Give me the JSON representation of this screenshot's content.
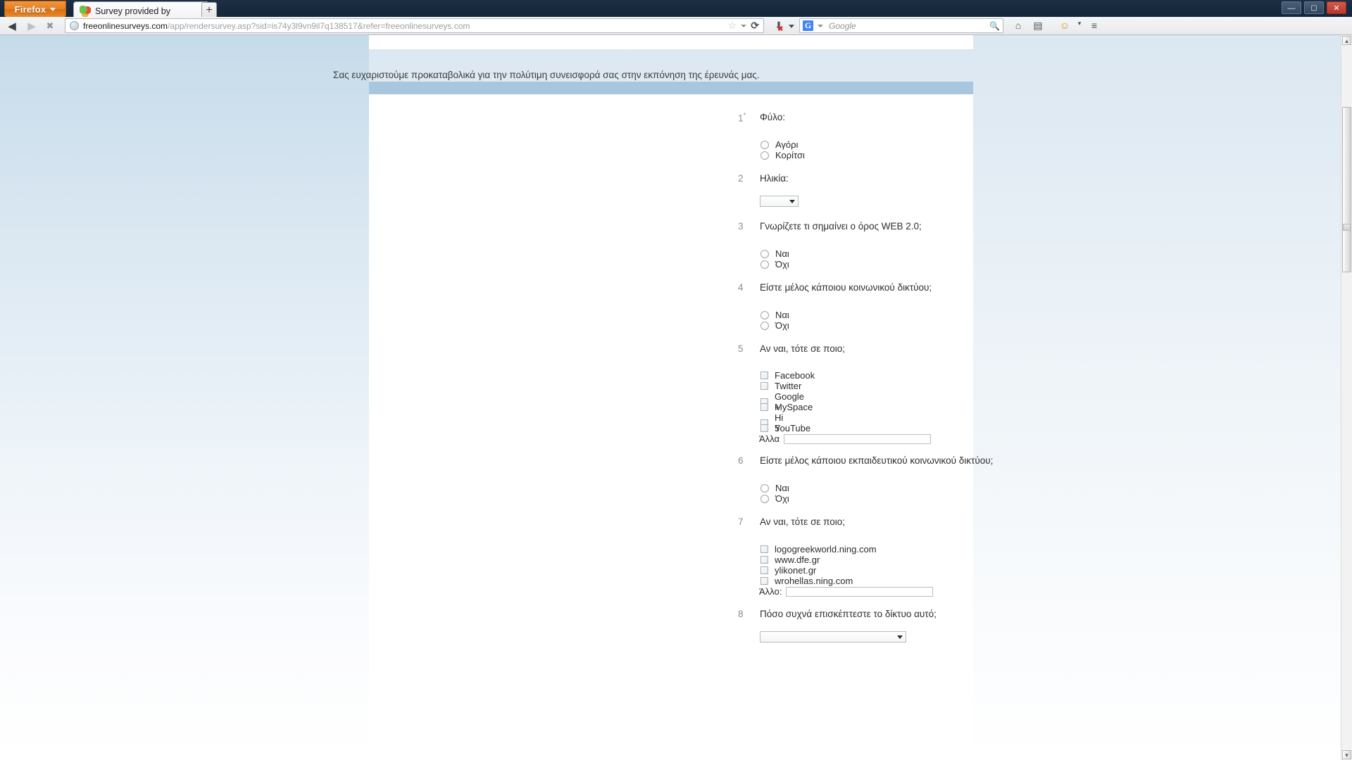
{
  "browser": {
    "firefox_button": "Firefox",
    "tab_title": "Survey provided by",
    "new_tab_label": "+",
    "back_icon": "◀",
    "forward_icon": "▶",
    "stop_icon": "✖",
    "url_host": "freeonlinesurveys.com",
    "url_path": "/app/rendersurvey.asp?sid=is74y3l9vn9il7q138517&refer=freeonlinesurveys.com",
    "star_icon": "☆",
    "reload_icon": "⟳",
    "download_icon": "⬇",
    "search_engine": "G",
    "search_placeholder": "Google",
    "search_icon": "🔍",
    "home_icon": "⌂",
    "panel_icon": "▤",
    "smiley_icon": "☺",
    "menu_caret": "▾",
    "win_minimize": "—",
    "win_maximize": "▢",
    "win_close": "✕"
  },
  "survey": {
    "intro": "Σας ευχαριστούμε προκαταβολικά για την πολύτιμη συνεισφορά σας στην εκπόνηση της έρευνάς μας.",
    "required_marker": "*",
    "questions": [
      {
        "number": "1",
        "required": true,
        "text": "Φύλο:",
        "type": "radio",
        "options": [
          "Αγόρι",
          "Κορίτσι"
        ]
      },
      {
        "number": "2",
        "required": false,
        "text": "Ηλικία:",
        "type": "select",
        "selected": ""
      },
      {
        "number": "3",
        "required": false,
        "text": "Γνωρίζετε τι σημαίνει ο όρος WEB 2.0;",
        "type": "radio",
        "options": [
          "Ναι",
          "Όχι"
        ]
      },
      {
        "number": "4",
        "required": false,
        "text": "Είστε μέλος κάποιου κοινωνικού δικτύου;",
        "type": "radio",
        "options": [
          "Ναι",
          "Όχι"
        ]
      },
      {
        "number": "5",
        "required": false,
        "text": "Αν ναι, τότε σε ποιο;",
        "type": "checkbox",
        "options": [
          "Facebook",
          "Twitter",
          "Google +",
          "MySpace",
          "Hi 5",
          "YouTube"
        ],
        "other_label": "Άλλα",
        "other_value": ""
      },
      {
        "number": "6",
        "required": false,
        "text": "Είστε μέλος κάποιου εκπαιδευτικού κοινωνικού δικτύου;",
        "type": "radio",
        "options": [
          "Ναι",
          "Όχι"
        ]
      },
      {
        "number": "7",
        "required": false,
        "text": "Αν ναι, τότε σε ποιο;",
        "type": "checkbox",
        "options": [
          "logogreekworld.ning.com",
          "www.dfe.gr",
          "ylikonet.gr",
          "wrohellas.ning.com"
        ],
        "other_label": "Άλλο:",
        "other_value": ""
      },
      {
        "number": "8",
        "required": false,
        "text": "Πόσο συχνά επισκέπτεστε το δίκτυο αυτό;",
        "type": "select",
        "selected": ""
      }
    ]
  },
  "colors": {
    "page_bg": "#ffffff",
    "band": "#a8c6dd",
    "chrome_dark": "#17293d",
    "firefox_orange": "#e87f22",
    "question_number": "#8d8d8d",
    "question_text": "#2e2e2e"
  }
}
